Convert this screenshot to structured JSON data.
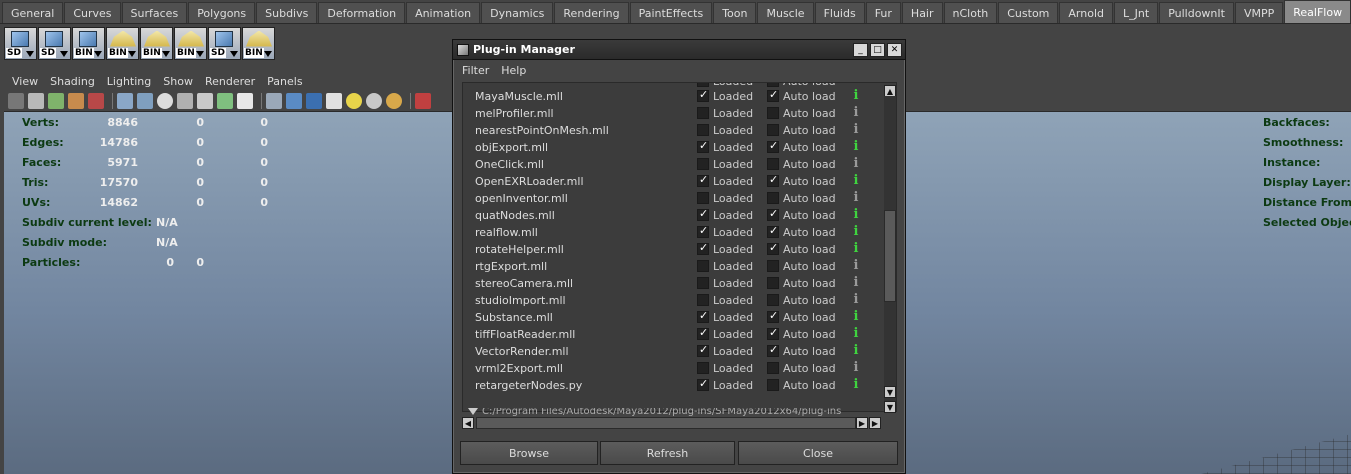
{
  "shelf": {
    "tabs": [
      "General",
      "Curves",
      "Surfaces",
      "Polygons",
      "Subdivs",
      "Deformation",
      "Animation",
      "Dynamics",
      "Rendering",
      "PaintEffects",
      "Toon",
      "Muscle",
      "Fluids",
      "Fur",
      "Hair",
      "nCloth",
      "Custom",
      "Arnold",
      "L_Jnt",
      "PulldownIt",
      "VMPP",
      "RealFlow"
    ],
    "active_tab": "RealFlow",
    "icon_tags": [
      "SD",
      "SD",
      "BIN",
      "BIN",
      "BIN",
      "BIN",
      "SD",
      "BIN"
    ]
  },
  "viewport": {
    "menus": [
      "View",
      "Shading",
      "Lighting",
      "Show",
      "Renderer",
      "Panels"
    ],
    "stats": {
      "labels": [
        "Verts:",
        "Edges:",
        "Faces:",
        "Tris:",
        "UVs:"
      ],
      "col1": [
        "8846",
        "14786",
        "5971",
        "17570",
        "14862"
      ],
      "col2": [
        "0",
        "0",
        "0",
        "0",
        "0"
      ],
      "col3": [
        "0",
        "0",
        "0",
        "0",
        "0"
      ],
      "subdiv_level_label": "Subdiv current level:",
      "subdiv_level_value": "N/A",
      "subdiv_mode_label": "Subdiv mode:",
      "subdiv_mode_value": "N/A",
      "particles_label": "Particles:",
      "particles_a": "0",
      "particles_b": "0"
    },
    "right_labels": [
      "Backfaces:",
      "Smoothness:",
      "Instance:",
      "Display Layer:",
      "Distance From C",
      "Selected Objects"
    ]
  },
  "dialog": {
    "title": "Plug-in Manager",
    "menus": [
      "Filter",
      "Help"
    ],
    "loaded_label": "Loaded",
    "autoload_label": "Auto load",
    "plugins": [
      {
        "name": "MayaMuscle.mll",
        "loaded": true,
        "autoload": true
      },
      {
        "name": "melProfiler.mll",
        "loaded": false,
        "autoload": false
      },
      {
        "name": "nearestPointOnMesh.mll",
        "loaded": false,
        "autoload": false
      },
      {
        "name": "objExport.mll",
        "loaded": true,
        "autoload": true
      },
      {
        "name": "OneClick.mll",
        "loaded": false,
        "autoload": false
      },
      {
        "name": "OpenEXRLoader.mll",
        "loaded": true,
        "autoload": true
      },
      {
        "name": "openInventor.mll",
        "loaded": false,
        "autoload": false
      },
      {
        "name": "quatNodes.mll",
        "loaded": true,
        "autoload": true
      },
      {
        "name": "realflow.mll",
        "loaded": true,
        "autoload": true
      },
      {
        "name": "rotateHelper.mll",
        "loaded": true,
        "autoload": true
      },
      {
        "name": "rtgExport.mll",
        "loaded": false,
        "autoload": false
      },
      {
        "name": "stereoCamera.mll",
        "loaded": false,
        "autoload": false
      },
      {
        "name": "studioImport.mll",
        "loaded": false,
        "autoload": false
      },
      {
        "name": "Substance.mll",
        "loaded": true,
        "autoload": true
      },
      {
        "name": "tiffFloatReader.mll",
        "loaded": true,
        "autoload": true
      },
      {
        "name": "VectorRender.mll",
        "loaded": true,
        "autoload": true
      },
      {
        "name": "vrml2Export.mll",
        "loaded": false,
        "autoload": false
      },
      {
        "name": "retargeterNodes.py",
        "loaded": true,
        "autoload": false
      }
    ],
    "path_text": "C:/Program Files/Autodesk/Maya2012/plug-ins/SFMaya2012x64/plug-ins",
    "buttons": {
      "browse": "Browse",
      "refresh": "Refresh",
      "close": "Close"
    },
    "colors": {
      "info_loaded": "#3fd43f",
      "info_unloaded": "#9a9a9a"
    }
  }
}
